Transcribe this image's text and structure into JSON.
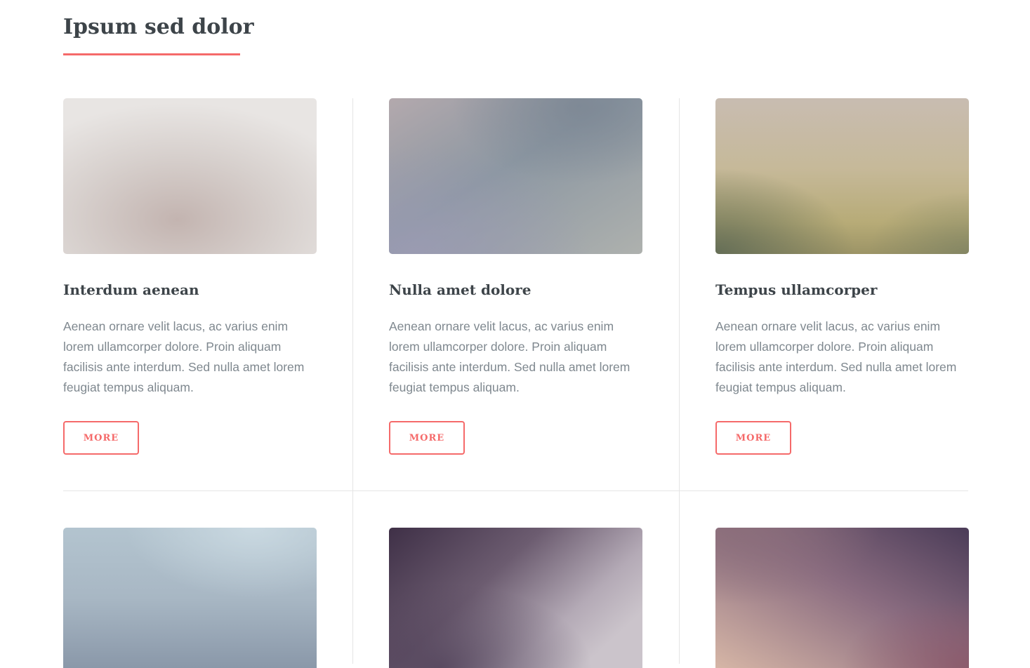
{
  "section": {
    "title": "Ipsum sed dolor",
    "accent_color": "#f56a6a"
  },
  "articles": [
    {
      "title": "Interdum aenean",
      "text": "Aenean ornare velit lacus, ac varius enim lorem ullamcorper dolore. Proin aliquam facilisis ante interdum. Sed nulla amet lorem feugiat tempus aliquam.",
      "button": "More"
    },
    {
      "title": "Nulla amet dolore",
      "text": "Aenean ornare velit lacus, ac varius enim lorem ullamcorper dolore. Proin aliquam facilisis ante interdum. Sed nulla amet lorem feugiat tempus aliquam.",
      "button": "More"
    },
    {
      "title": "Tempus ullamcorper",
      "text": "Aenean ornare velit lacus, ac varius enim lorem ullamcorper dolore. Proin aliquam facilisis ante interdum. Sed nulla amet lorem feugiat tempus aliquam.",
      "button": "More"
    }
  ]
}
